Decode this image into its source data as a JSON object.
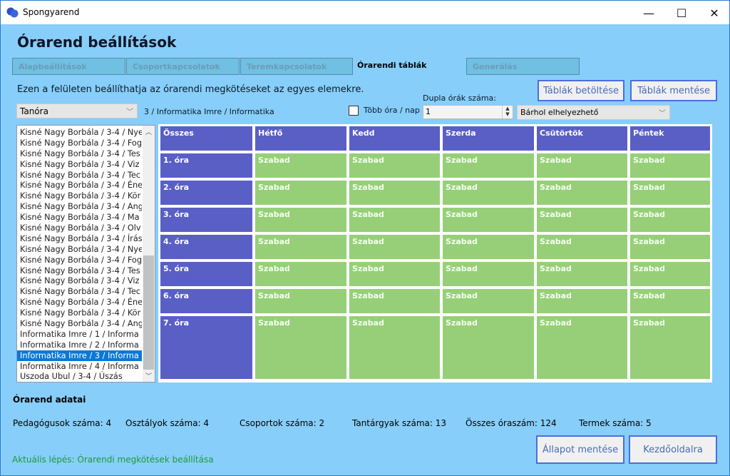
{
  "window": {
    "title": "Spongyarend",
    "minimize_icon": "minimize-icon",
    "maximize_icon": "maximize-icon",
    "close_icon": "close-icon"
  },
  "page_title": "Órarend beállítások",
  "tabs": [
    {
      "label": "Alapbeállítások"
    },
    {
      "label": "Csoportkapcsolatok"
    },
    {
      "label": "Teremkapcsolatok"
    },
    {
      "label": "Órarendi táblák",
      "active": true
    },
    {
      "label": "Generálás"
    }
  ],
  "description": "Ezen a felületen beállíthatja az órarendi megkötéseket az egyes elemekre.",
  "buttons": {
    "load": "Táblák betöltése",
    "save": "Táblák mentése",
    "save_state": "Állapot mentése",
    "home": "Kezdőoldalra"
  },
  "type_combo": {
    "value": "Tanóra"
  },
  "selected_label": "3 / Informatika Imre / Informatika",
  "multi_per_day": {
    "label": "Több óra / nap",
    "checked": false
  },
  "double_lessons": {
    "label": "Dupla órák száma:",
    "value": "1"
  },
  "placement_combo": {
    "value": "Bárhol elhelyezhető"
  },
  "list": {
    "items": [
      "Kisné Nagy Borbála / 3-4 / Nye",
      "Kisné Nagy Borbála / 3-4 / Fog",
      "Kisné Nagy Borbála / 3-4 / Tes",
      "Kisné Nagy Borbála / 3-4 / Viz",
      "Kisné Nagy Borbála / 3-4 / Tec",
      "Kisné Nagy Borbála / 3-4 / Éne",
      "Kisné Nagy Borbála / 3-4 / Kör",
      "Kisné Nagy Borbála / 3-4 / Ang",
      "Kisné Nagy Borbála / 3-4 / Ma",
      "Kisné Nagy Borbála / 3-4 / Olv",
      "Kisné Nagy Borbála / 3-4 / Írás",
      "Kisné Nagy Borbála / 3-4 / Nye",
      "Kisné Nagy Borbála / 3-4 / Fog",
      "Kisné Nagy Borbála / 3-4 / Tes",
      "Kisné Nagy Borbála / 3-4 / Viz",
      "Kisné Nagy Borbála / 3-4 / Tec",
      "Kisné Nagy Borbála / 3-4 / Éne",
      "Kisné Nagy Borbála / 3-4 / Kör",
      "Kisné Nagy Borbála / 3-4 / Ang",
      "Informatika Imre / 1 / Informa",
      "Informatika Imre / 2 / Informa",
      "Informatika Imre / 3 / Informa",
      "Informatika Imre / 4 / Informa",
      "Uszoda Ubul / 3-4 / Úszás"
    ],
    "selected_index": 21
  },
  "grid": {
    "corner": "Összes",
    "days": [
      "Hétfő",
      "Kedd",
      "Szerda",
      "Csütörtök",
      "Péntek"
    ],
    "periods": [
      "1. óra",
      "2. óra",
      "3. óra",
      "4. óra",
      "5. óra",
      "6. óra",
      "7. óra"
    ],
    "cell_value": "Szabad",
    "colors": {
      "header": "#5a5fc6",
      "free": "#96cf78"
    }
  },
  "summary": {
    "title": "Órarend adatai",
    "stats": [
      "Pedagógusok száma: 4",
      "Osztályok száma: 4",
      "Csoportok száma: 2",
      "Tantárgyak száma: 13",
      "Összes óraszám: 124",
      "Termek száma: 5"
    ]
  },
  "status": "Aktuális lépés: Órarendi megkötések beállítása"
}
